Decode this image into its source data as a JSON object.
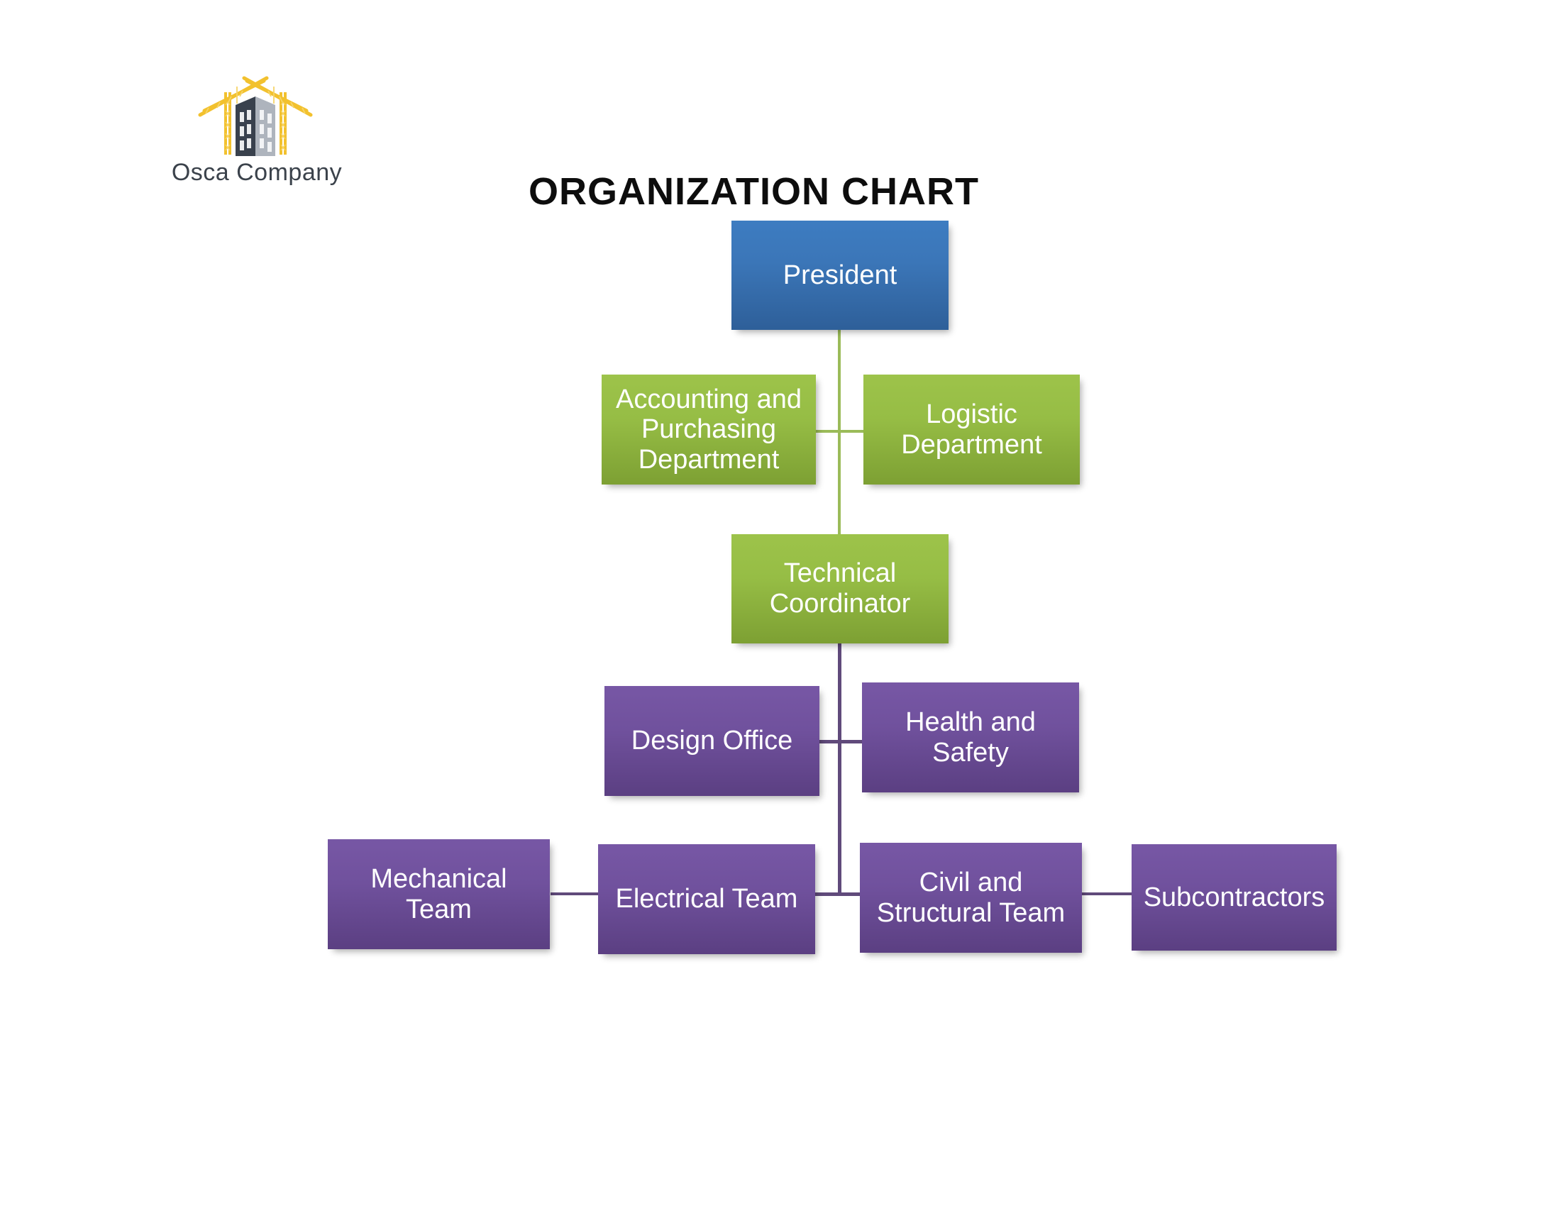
{
  "brand": {
    "name": "Osca Company",
    "logo_icon": "construction-crane-building-icon"
  },
  "header": {
    "title": "ORGANIZATION CHART"
  },
  "colors": {
    "blue": "#3b76b8",
    "green": "#96bd45",
    "purple": "#70519d",
    "title_text": "#0d0d0d",
    "brand_text": "#3b424b",
    "logo_crane": "#f2c12e",
    "logo_building": "#3b424b",
    "canvas": "#ffffff"
  },
  "chart_data": {
    "type": "diagram",
    "title": "ORGANIZATION CHART",
    "nodes": [
      {
        "id": "president",
        "label": "President",
        "level": 1,
        "color": "blue"
      },
      {
        "id": "accounting",
        "label": "Accounting and Purchasing Department",
        "level": 2,
        "color": "green"
      },
      {
        "id": "logistic",
        "label": "Logistic Department",
        "level": 2,
        "color": "green"
      },
      {
        "id": "technical",
        "label": "Technical Coordinator",
        "level": 3,
        "color": "green"
      },
      {
        "id": "design",
        "label": "Design Office",
        "level": 4,
        "color": "purple"
      },
      {
        "id": "health",
        "label": "Health and Safety",
        "level": 4,
        "color": "purple"
      },
      {
        "id": "mechanical",
        "label": "Mechanical Team",
        "level": 5,
        "color": "purple"
      },
      {
        "id": "electrical",
        "label": "Electrical Team",
        "level": 5,
        "color": "purple"
      },
      {
        "id": "civil",
        "label": "Civil and Structural Team",
        "level": 5,
        "color": "purple"
      },
      {
        "id": "subcontract",
        "label": "Subcontractors",
        "level": 5,
        "color": "purple"
      }
    ],
    "edges": [
      {
        "from": "president",
        "to": "accounting"
      },
      {
        "from": "president",
        "to": "logistic"
      },
      {
        "from": "president",
        "to": "technical"
      },
      {
        "from": "technical",
        "to": "design"
      },
      {
        "from": "technical",
        "to": "health"
      },
      {
        "from": "technical",
        "to": "mechanical"
      },
      {
        "from": "technical",
        "to": "electrical"
      },
      {
        "from": "technical",
        "to": "civil"
      },
      {
        "from": "technical",
        "to": "subcontract"
      }
    ]
  },
  "nodes": {
    "president": {
      "label": "President"
    },
    "accounting": {
      "line1": "Accounting and",
      "line2": "Purchasing",
      "line3": "Department"
    },
    "logistic": {
      "line1": "Logistic",
      "line2": "Department"
    },
    "technical": {
      "line1": "Technical",
      "line2": "Coordinator"
    },
    "design": {
      "label": "Design Office"
    },
    "health": {
      "line1": "Health and",
      "line2": "Safety"
    },
    "mechanical": {
      "line1": "Mechanical",
      "line2": "Team"
    },
    "electrical": {
      "label": "Electrical Team"
    },
    "civil": {
      "line1": "Civil and",
      "line2": "Structural Team"
    },
    "subcontract": {
      "label": "Subcontractors"
    }
  }
}
